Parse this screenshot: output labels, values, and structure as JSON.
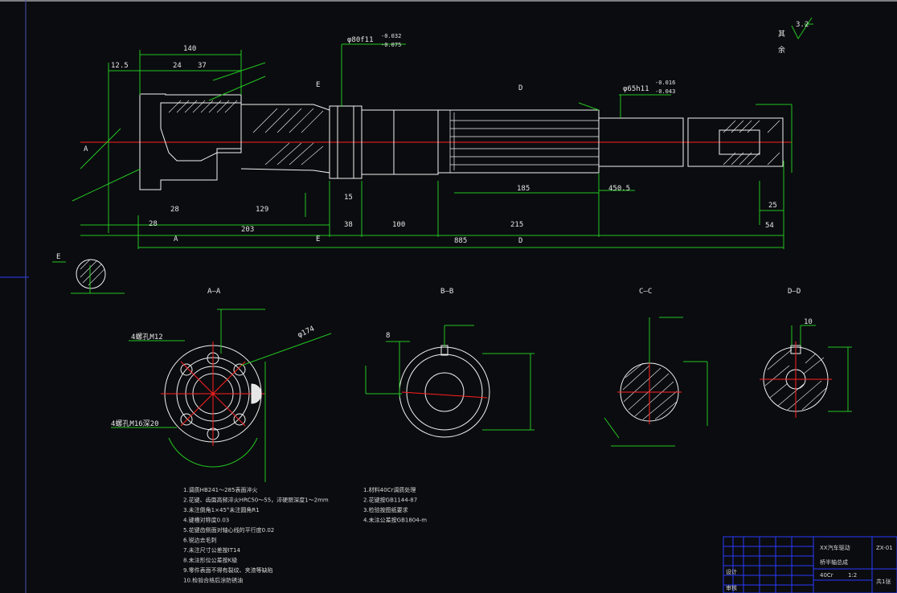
{
  "colors": {
    "background": "#0b0c0f",
    "outline": "#f2f2f2",
    "dimension": "#22c322",
    "centerline": "#ff2020",
    "frame": "#2a3aff"
  },
  "roughness": {
    "label_1": "其",
    "label_2": "余",
    "value": "3.2"
  },
  "main_dims": {
    "d_140": "140",
    "d_12_5": "12.5",
    "d_24": "24",
    "d_37": "37",
    "d_203": "203",
    "d_129": "129",
    "d_28": "28",
    "d_38": "38",
    "d_100": "100",
    "d_215": "215",
    "d_885": "885",
    "d_185": "185",
    "d_54": "54",
    "d_25": "25",
    "d_28b": "28",
    "d_15": "15",
    "d_450_5": "450.5",
    "tol_top": "-0.032",
    "tol_bot": "-0.075",
    "tol2_top": "-0.016",
    "tol2_bot": "-0.043",
    "fit_label": "φ80f11",
    "fit_label2": "φ65h11",
    "label_d": "D",
    "label_e": "E",
    "label_c": "C",
    "label_b": "B",
    "label_a": "A"
  },
  "sections": {
    "aa": "A—A",
    "bb": "B—B",
    "cc": "C—C",
    "dd": "D—D",
    "e_view": "E"
  },
  "section_notes": {
    "aa_holes_1": "4螺孔M12",
    "aa_holes_2": "4螺孔M16深20",
    "aa_dia": "φ174",
    "bb_dim": "8",
    "dd_dim": "10"
  },
  "tech_notes": [
    "1.调质HB241～285表面淬火",
    "2.花键、齿面高频淬火HRC50～55，淬硬层深度1～2mm",
    "3.未注倒角1×45°未注圆角R1",
    "4.键槽对称度0.03",
    "5.花键齿侧面对轴心线的平行度0.02",
    "6.锐边去毛刺",
    "7.未注尺寸公差按IT14",
    "8.未注形位公差按K级",
    "9.零件表面不得有裂纹、夹渣等缺陷",
    "10.检验合格后涂防锈油"
  ],
  "tech_notes_right": [
    "1.材料40Cr调质处理",
    "2.花键按GB1144-87",
    "3.检验按图纸要求",
    "4.未注公差按GB1804-m"
  ],
  "title_block": {
    "part_name_1": "XX汽车驱动",
    "part_name_2": "桥半轴总成",
    "drawing_no": "ZX-01",
    "material": "40Cr",
    "scale": "1:2",
    "sheet": "共1张",
    "designer": "设计",
    "checker": "审核"
  }
}
